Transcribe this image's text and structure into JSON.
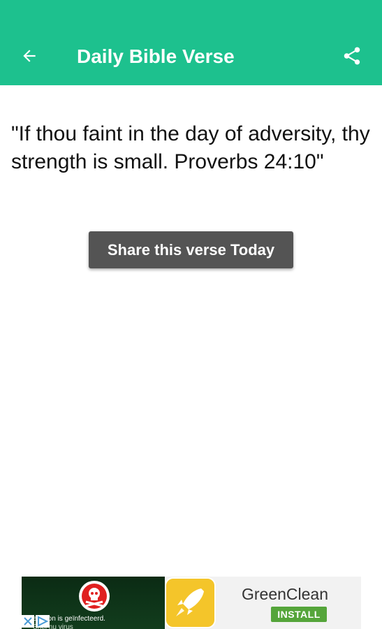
{
  "app_bar": {
    "title": "Daily Bible Verse",
    "back_icon": "arrow-left-icon",
    "share_icon": "share-icon",
    "background_color": "#1dc18e"
  },
  "verse": {
    "text": "\"If thou faint in the day of adversity, thy strength is small. Proverbs 24:10\""
  },
  "share_button": {
    "label": "Share this verse Today",
    "background_color": "#545454"
  },
  "ad": {
    "left_text_line1": "elefoon is geïnfecteerd.",
    "left_text_line2": "Snel nu virus",
    "app_name": "GreenClean",
    "install_label": "INSTALL",
    "icons": [
      "warning-skull-icon",
      "rocket-icon",
      "adchoices-icon",
      "close-x-icon"
    ],
    "install_color": "#55a53a"
  }
}
